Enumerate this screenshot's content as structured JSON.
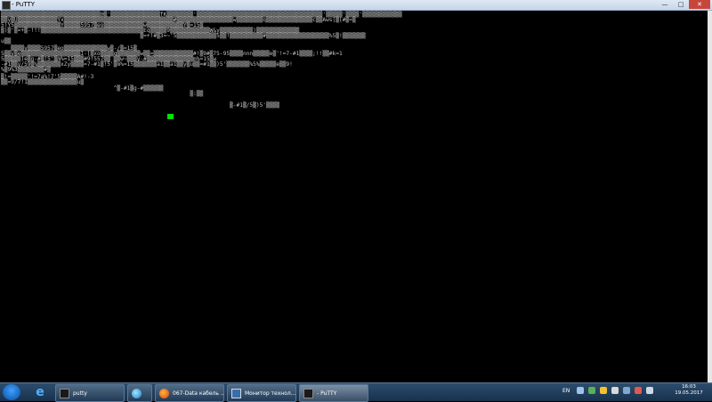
{
  "window": {
    "title": "- PuTTY"
  },
  "terminal": {
    "lines": [
      "▒▒▒▒▒▒▒▒▒▒▒▒▒▒▒▒▒▒▒▒▒▒▒▒▒▒▒▒▒▒@▒'▒▒▒▒▒▒▒▒▒▒▒▒▒▒▒fK▒▒▒▒▒▒▒▒'▒▒▒▒▒▒▒▒▒▒▒▒▒▒▒▒▒▒▒▒▒▒▒▒▒▒▒▒▒▒▒▒▒▒▒▒▒▒'▒▒▒▒▒'▒▒▒▒'▒▒▒▒▒▒▒▒▒▒▒▒",
      "▒▒y▒U▒▒▒▒▒▒▒▒▒▒▒▒Yx▒▒▒▒▒▒▒▒▒▒▒▒▒▒▒▒▒▒▒▒▒▒▒▒▒▒▒▒▒▒▒▒▒#▒▒▒▒▒▒▒▒▒▒▒▒▒▒▒▒▒w▒▒▒▒▒▒▒▒q▒▒▒▒▒▒▒▒▒▒▒▒▒▒c▒▒Aws[▒[#▒=▒",
      "5)Y5▒▒▒▒▒▒▒▒▒▒▒▒▒▒Y▒▒▒▒▒5957▒eo▒▒▒▒▒▒▒▒▒▒▒▒w▒▒▒▒▒▒▒▒▒▒▒Y▒=15▒",
      "▒)▒'▒=+▒-!!!▒▒▒▒▒▒▒▒▒▒▒▒▒▒▒▒▒▒▒▒▒▒▒▒▒▒▒▒▒▒▒Eq▒▒▒▒▒9▒▒▒▒▒▒▒▒▒▒▒▒W&y▒▒▒▒▒▒▒▒▒▒)▒▒▒▒▒▒▒▒▒▒▒▒▒",
      "                                          ▒=+!#▒3=~'5▒▒▒▒▒▒▒▒▒▒▒▒5▒▒!▒▒▒▒▒▒▒▒▒▒#▒▒▒▒▒▒▒▒▒▒▒▒▒▒▒▒▒▒▒%5▒!▒▒▒▒▒▒▒",
      "u▒▒",
      "   ▒▒▒▒y▒▒▒▒5957▒eo▒▒▒▒▒▒▒▒▒▒▒▒▒w▒-/▒=15▒",
      "5▒▒y▒e▒▒▒▒▒▒▒▒▒▒▒▒▒▒▒▒▒▒I-[▒xo▒▒▒▒q▒▒▒▒▒▒▒w▒▒=▒▒▒▒▒▒▒▒▒▒▒▒#!▒9#▒75-95▒▒▒▒nnn▒▒▒▒▒e▒'!=7-#1▒▒▒▒;!!▒▒#k=1",
      "5▒▒▒▒▒]e▒g-#▒!5'▒m%=15▒▒▒#9!557▒▒ ▒▒w~▒▒▒y-#▒▒▒▒▒▒▒▒▒▒▒▒▒▒m%=15▒w",
      "-#1▒▒y/59▒%▒▒▒▒▒▒▒xZy▒▒▒▒=7-#1▒!5'▒m%=15▒▒▒▒▒▒▒a1▒▒a1▒▒y▒u▒▒=#1▒▒)5'▒▒▒▒▒▒▒%5%▒▒▒▒▒e▒▒9!",
      "%▒9%3▒▒▒▒▒▒▒▒#▒",
      "▒!=▒▒▒▒▒'!=7a%!7'5▒▒▒▒▒A#!-3",
      "▒▒=9/7!1▒▒▒▒▒▒▒▒▒▒▒▒▒▒▒u▒",
      "                                  ^▒-#1▒g-#▒▒▒▒▒▒",
      "                                                         ▒:▒▒",
      "",
      "                                                                     ▒-#1▒/5▒)5'▒▒▒▒"
    ]
  },
  "taskbar": {
    "tasks": [
      {
        "label": "putty"
      },
      {
        "label": ""
      },
      {
        "label": "067-Data кабель ..."
      },
      {
        "label": "Монитор технол..."
      },
      {
        "label": "- PuTTY"
      }
    ],
    "language": "EN",
    "clock": {
      "time": "16:03",
      "date": "19.05.2017"
    }
  }
}
